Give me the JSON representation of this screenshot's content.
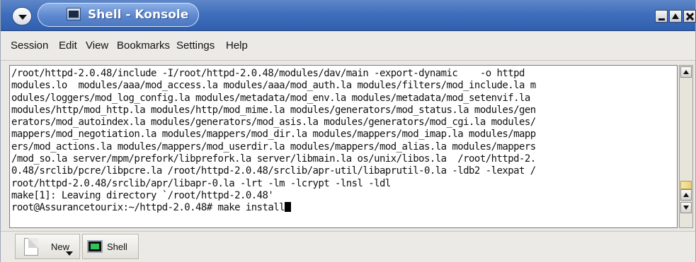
{
  "window": {
    "title": "Shell - Konsole"
  },
  "menubar": {
    "items": [
      "Session",
      "Edit",
      "View",
      "Bookmarks",
      "Settings",
      "Help"
    ]
  },
  "terminal": {
    "lines": [
      "/root/httpd-2.0.48/include -I/root/httpd-2.0.48/modules/dav/main -export-dynamic    -o httpd",
      "modules.lo  modules/aaa/mod_access.la modules/aaa/mod_auth.la modules/filters/mod_include.la m",
      "odules/loggers/mod_log_config.la modules/metadata/mod_env.la modules/metadata/mod_setenvif.la",
      "modules/http/mod_http.la modules/http/mod_mime.la modules/generators/mod_status.la modules/gen",
      "erators/mod_autoindex.la modules/generators/mod_asis.la modules/generators/mod_cgi.la modules/",
      "mappers/mod_negotiation.la modules/mappers/mod_dir.la modules/mappers/mod_imap.la modules/mapp",
      "ers/mod_actions.la modules/mappers/mod_userdir.la modules/mappers/mod_alias.la modules/mappers",
      "/mod_so.la server/mpm/prefork/libprefork.la server/libmain.la os/unix/libos.la  /root/httpd-2.",
      "0.48/srclib/pcre/libpcre.la /root/httpd-2.0.48/srclib/apr-util/libaprutil-0.la -ldb2 -lexpat /",
      "root/httpd-2.0.48/srclib/apr/libapr-0.la -lrt -lm -lcrypt -lnsl -ldl",
      "make[1]: Leaving directory `/root/httpd-2.0.48'",
      "root@Assurancetourix:~/httpd-2.0.48# make install"
    ]
  },
  "tabbar": {
    "new_label": "New",
    "shell_label": "Shell"
  },
  "icons": {
    "window_menu": "chevron-down-icon",
    "app": "konsole-icon",
    "minimize": "minimize-icon",
    "maximize": "maximize-icon",
    "close": "close-icon",
    "new_doc": "document-icon",
    "shell": "terminal-icon"
  }
}
